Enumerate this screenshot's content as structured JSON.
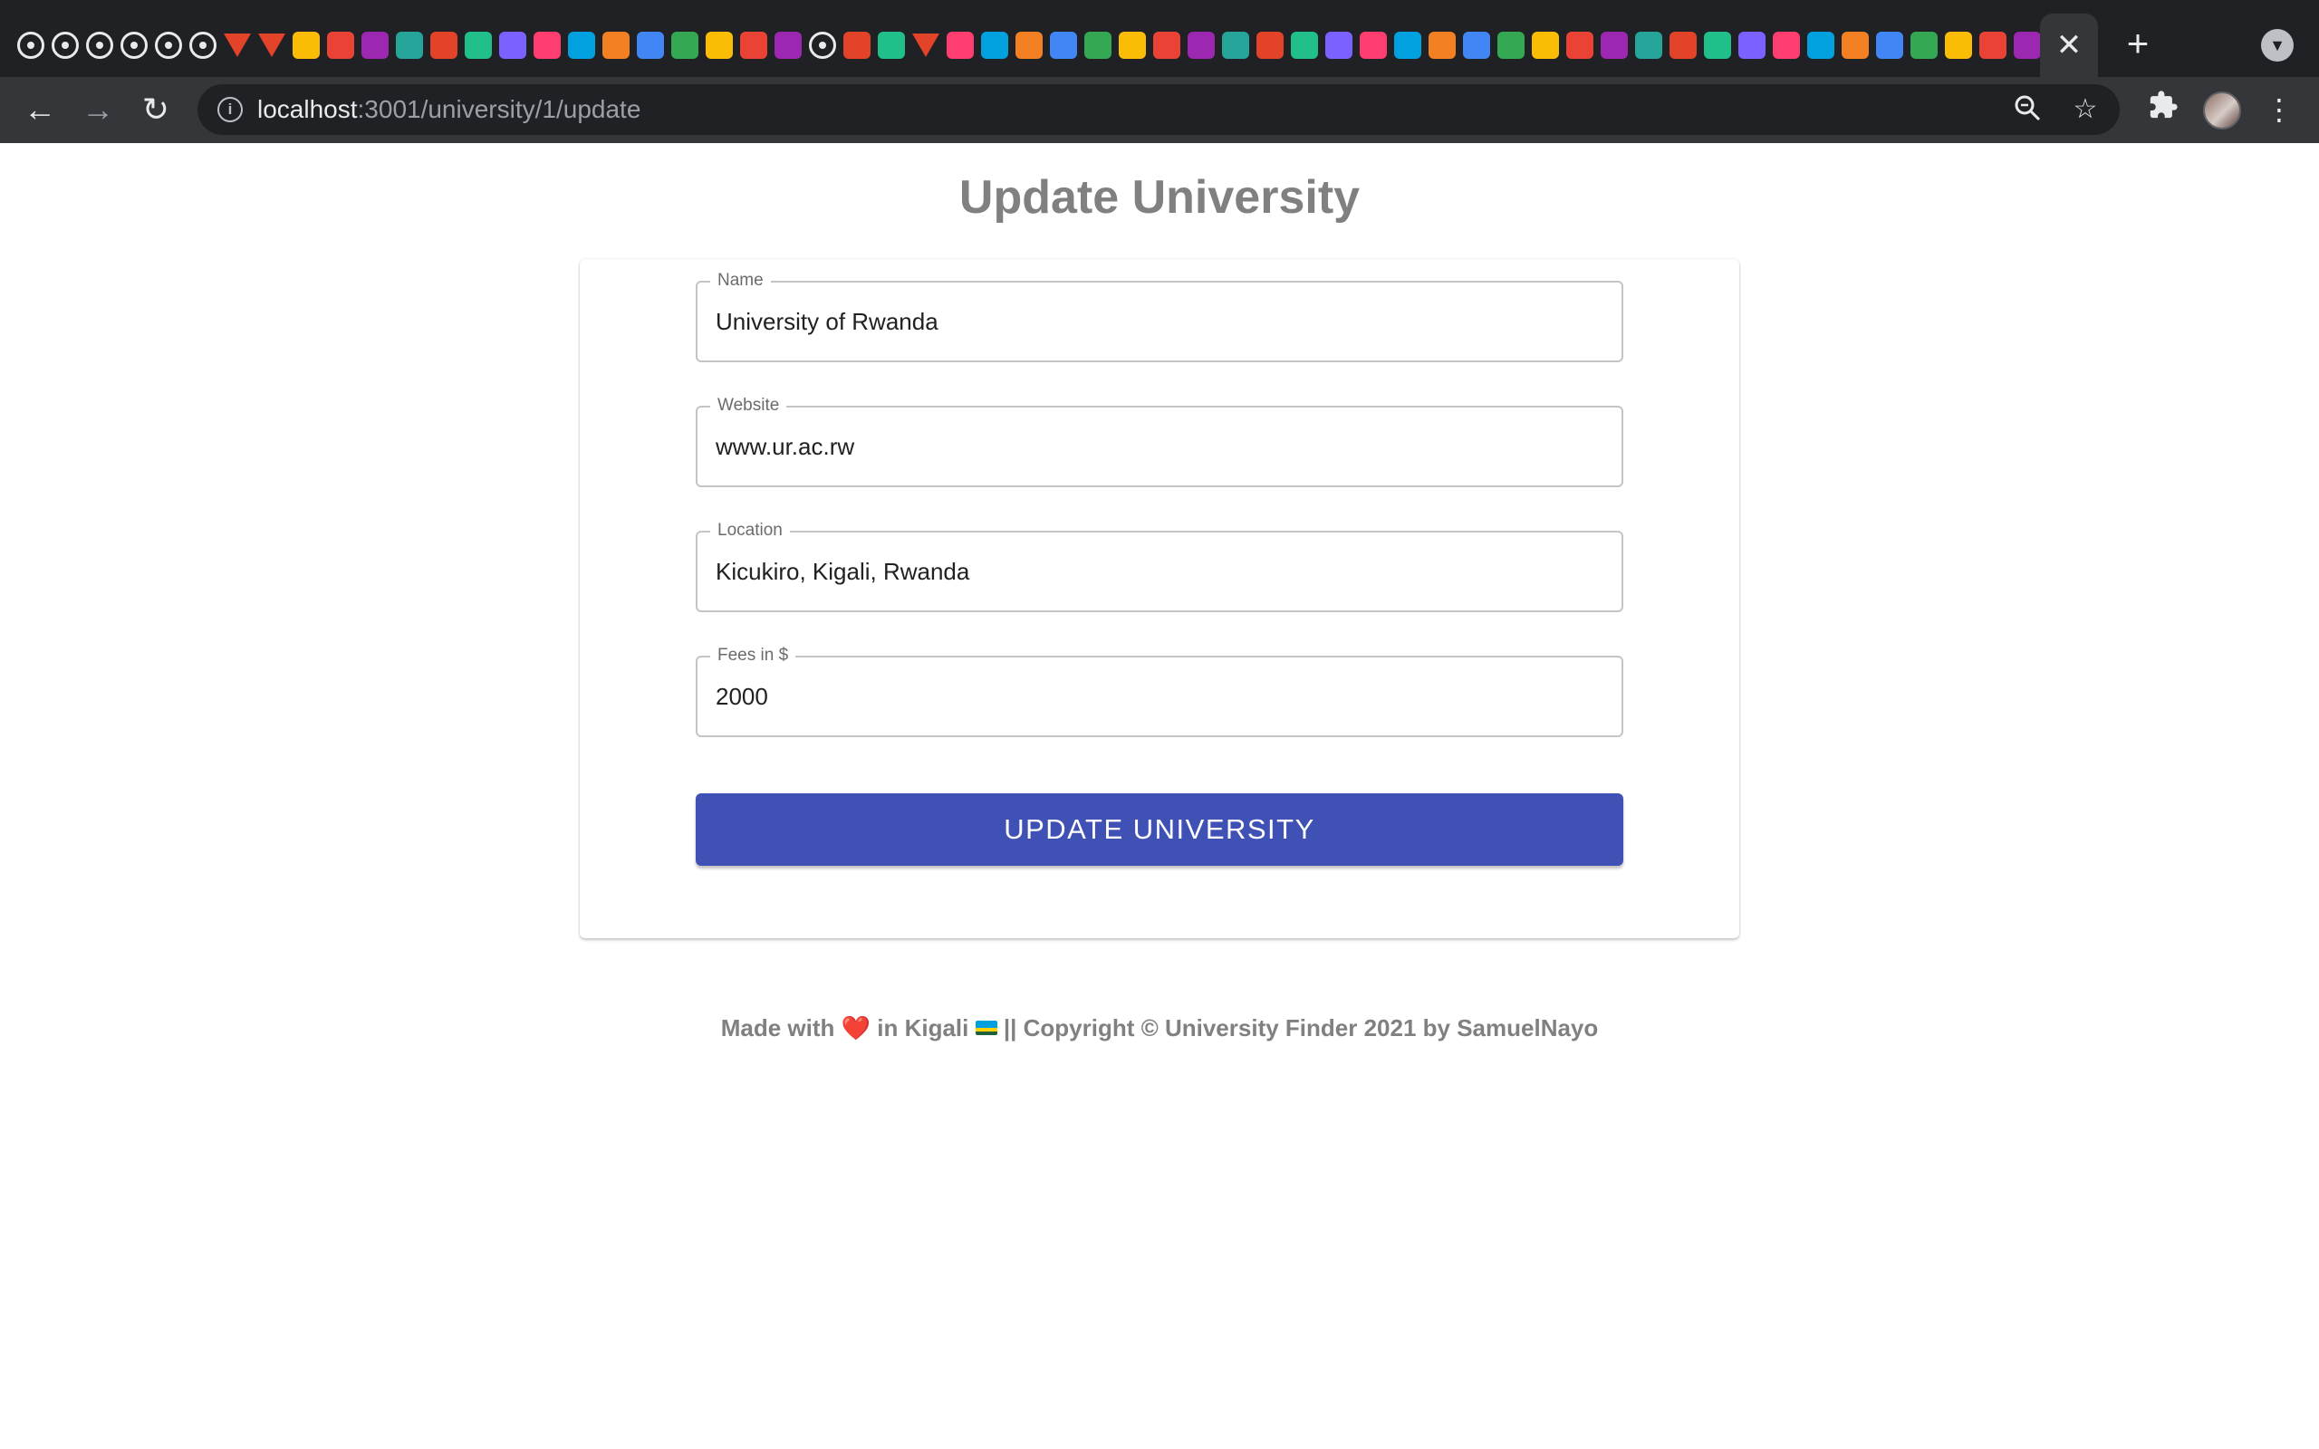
{
  "browser": {
    "url_host": "localhost",
    "url_path": ":3001/university/1/update",
    "icons": {
      "back": "arrow-left-icon",
      "forward": "arrow-right-icon",
      "reload": "reload-icon",
      "site_info": "info-icon",
      "zoom": "magnifier-icon",
      "bookmark": "star-icon",
      "extensions": "puzzle-icon",
      "menu": "kebab-menu-icon",
      "close_tab": "close-icon",
      "new_tab": "plus-icon",
      "tab_search": "chevron-down-icon"
    },
    "pinned_favicons": [
      "github-icon",
      "github-icon",
      "github-icon",
      "github-icon",
      "github-icon",
      "github-icon",
      "gitlab-icon",
      "gitlab-icon",
      "diamond-icon",
      "h-icon",
      "circle-icon",
      "v-icon",
      "hn-icon",
      "x-icon",
      "play-icon",
      "triangle-icon",
      "seven-icon",
      "instagram-icon",
      "r-icon",
      "ubuntu-icon",
      "a-icon",
      "a-icon",
      "globe-icon",
      "github-icon",
      "tool-icon",
      "refresh-icon",
      "gitlab-icon",
      "dev-icon",
      "box-icon",
      "box-icon",
      "docs-icon",
      "l-icon",
      "square-icon",
      "square-icon",
      "p-icon",
      "circle-icon",
      "calendar-icon",
      "gmail-icon",
      "drive-icon",
      "globe-icon",
      "page-icon",
      "flag-icon",
      "nasa-icon",
      "moon-icon",
      "maple-icon",
      "brush-icon",
      "figure-icon",
      "globe-icon",
      "python-icon",
      "python-icon",
      "python-icon",
      "google-icon",
      "stack-icon",
      "mountain-icon",
      "dots-icon",
      "grid-icon",
      "cursor-icon",
      "bag-icon",
      "shield-icon",
      "p-icon"
    ],
    "colors": {
      "tabstrip": "#202124",
      "toolbar": "#35363a"
    }
  },
  "page": {
    "title": "Update University",
    "form": {
      "name": {
        "label": "Name",
        "value": "University of Rwanda"
      },
      "website": {
        "label": "Website",
        "value": "www.ur.ac.rw"
      },
      "location": {
        "label": "Location",
        "value": "Kicukiro, Kigali, Rwanda"
      },
      "fees": {
        "label": "Fees in $",
        "value": "2000"
      },
      "submit_label": "UPDATE UNIVERSITY"
    },
    "footer": {
      "made_with": "Made with",
      "heart": "❤️",
      "in_city": "in Kigali",
      "flag": "rwanda-flag-icon",
      "copyright": "|| Copyright © University Finder 2021 by SamuelNayo"
    },
    "colors": {
      "primary": "#3f51b5",
      "heading": "#808080",
      "heart": "#e53935"
    }
  }
}
